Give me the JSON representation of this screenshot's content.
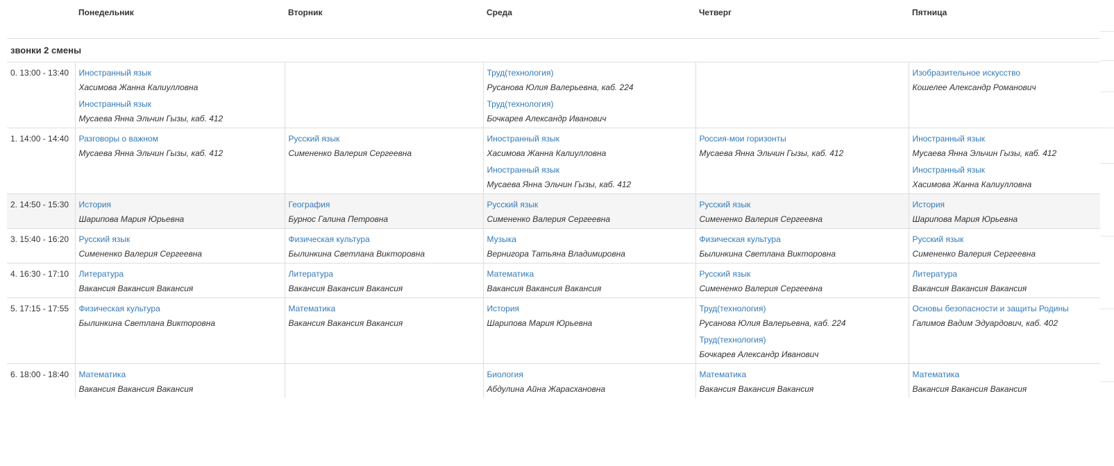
{
  "days": [
    "Понедельник",
    "Вторник",
    "Среда",
    "Четверг",
    "Пятница"
  ],
  "shift_title": "звонки 2 смены",
  "rows": [
    {
      "time": "0. 13:00 - 13:40",
      "cells": [
        [
          {
            "subject": "Иностранный язык",
            "teacher": "Хасимова Жанна Калиулловна"
          },
          {
            "subject": "Иностранный язык",
            "teacher": "Мусаева Янна Эльчин Гызы, каб. 412"
          }
        ],
        [],
        [
          {
            "subject": "Труд(технология)",
            "teacher": "Русанова Юлия Валерьевна, каб. 224"
          },
          {
            "subject": "Труд(технология)",
            "teacher": "Бочкарев Александр Иванович"
          }
        ],
        [],
        [
          {
            "subject": "Изобразительное искусство",
            "teacher": "Кошелее Александр Романович"
          }
        ]
      ]
    },
    {
      "time": "1. 14:00 - 14:40",
      "cells": [
        [
          {
            "subject": "Разговоры о важном",
            "teacher": "Мусаева Янна Эльчин Гызы, каб. 412"
          }
        ],
        [
          {
            "subject": "Русский язык",
            "teacher": "Симененко Валерия Сергеевна"
          }
        ],
        [
          {
            "subject": "Иностранный язык",
            "teacher": "Хасимова Жанна Калиулловна"
          },
          {
            "subject": "Иностранный язык",
            "teacher": "Мусаева Янна Эльчин Гызы, каб. 412"
          }
        ],
        [
          {
            "subject": "Россия-мои горизонты",
            "teacher": "Мусаева Янна Эльчин Гызы, каб. 412"
          }
        ],
        [
          {
            "subject": "Иностранный язык",
            "teacher": "Мусаева Янна Эльчин Гызы, каб. 412"
          },
          {
            "subject": "Иностранный язык",
            "teacher": "Хасимова Жанна Калиулловна"
          }
        ]
      ]
    },
    {
      "time": "2. 14:50 - 15:30",
      "highlight": true,
      "cells": [
        [
          {
            "subject": "История",
            "teacher": "Шарипова Мария Юрьевна"
          }
        ],
        [
          {
            "subject": "География",
            "teacher": "Бурнос Галина Петровна"
          }
        ],
        [
          {
            "subject": "Русский язык",
            "teacher": "Симененко Валерия Сергеевна"
          }
        ],
        [
          {
            "subject": "Русский язык",
            "teacher": "Симененко Валерия Сергеевна"
          }
        ],
        [
          {
            "subject": "История",
            "teacher": "Шарипова Мария Юрьевна"
          }
        ]
      ]
    },
    {
      "time": "3. 15:40 - 16:20",
      "cells": [
        [
          {
            "subject": "Русский язык",
            "teacher": "Симененко Валерия Сергеевна"
          }
        ],
        [
          {
            "subject": "Физическая культура",
            "teacher": "Былинкина Светлана Викторовна"
          }
        ],
        [
          {
            "subject": "Музыка",
            "teacher": "Вернигора Татьяна Владимировна"
          }
        ],
        [
          {
            "subject": "Физическая культура",
            "teacher": "Былинкина Светлана Викторовна"
          }
        ],
        [
          {
            "subject": "Русский язык",
            "teacher": "Симененко Валерия Сергеевна"
          }
        ]
      ]
    },
    {
      "time": "4. 16:30 - 17:10",
      "cells": [
        [
          {
            "subject": "Литература",
            "teacher": "Вакансия Вакансия Вакансия"
          }
        ],
        [
          {
            "subject": "Литература",
            "teacher": "Вакансия Вакансия Вакансия"
          }
        ],
        [
          {
            "subject": "Математика",
            "teacher": "Вакансия Вакансия Вакансия"
          }
        ],
        [
          {
            "subject": "Русский язык",
            "teacher": "Симененко Валерия Сергеевна"
          }
        ],
        [
          {
            "subject": "Литература",
            "teacher": "Вакансия Вакансия Вакансия"
          }
        ]
      ]
    },
    {
      "time": "5. 17:15 - 17:55",
      "cells": [
        [
          {
            "subject": "Физическая культура",
            "teacher": "Былинкина Светлана Викторовна"
          }
        ],
        [
          {
            "subject": "Математика",
            "teacher": "Вакансия Вакансия Вакансия"
          }
        ],
        [
          {
            "subject": "История",
            "teacher": "Шарипова Мария Юрьевна"
          }
        ],
        [
          {
            "subject": "Труд(технология)",
            "teacher": "Русанова Юлия Валерьевна, каб. 224"
          },
          {
            "subject": "Труд(технология)",
            "teacher": "Бочкарев Александр Иванович"
          }
        ],
        [
          {
            "subject": "Основы безопасности и защиты Родины",
            "teacher": "Галимов Вадим Эдуардович, каб. 402"
          }
        ]
      ]
    },
    {
      "time": "6. 18:00 - 18:40",
      "cells": [
        [
          {
            "subject": "Математика",
            "teacher": "Вакансия Вакансия Вакансия"
          }
        ],
        [],
        [
          {
            "subject": "Биология",
            "teacher": "Абдулина Айна Жарасхановна"
          }
        ],
        [
          {
            "subject": "Математика",
            "teacher": "Вакансия Вакансия Вакансия"
          }
        ],
        [
          {
            "subject": "Математика",
            "teacher": "Вакансия Вакансия Вакансия"
          }
        ]
      ]
    }
  ]
}
